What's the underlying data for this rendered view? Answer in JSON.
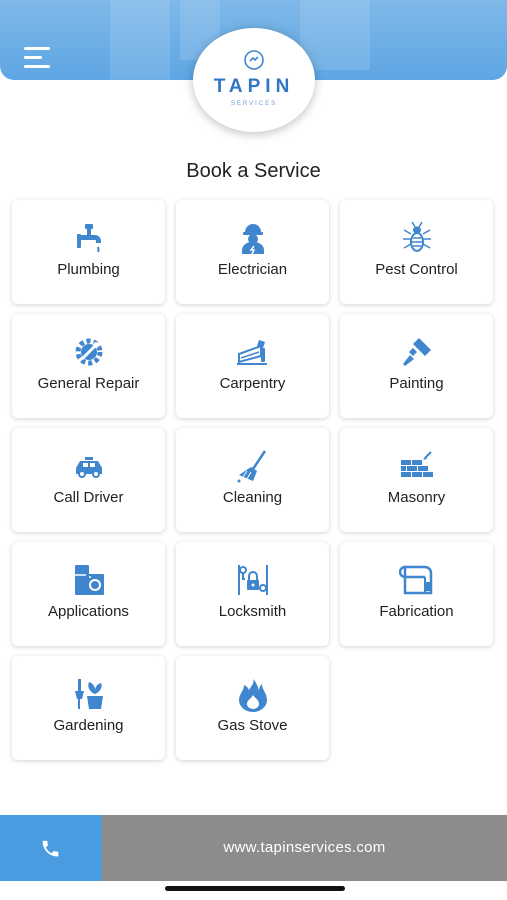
{
  "header": {
    "logo_name": "TAPIN",
    "logo_sub": "SERVICES"
  },
  "page_title": "Book a Service",
  "services": [
    {
      "label": "Plumbing",
      "icon": "faucet-icon"
    },
    {
      "label": "Electrician",
      "icon": "electrician-icon"
    },
    {
      "label": "Pest Control",
      "icon": "bug-icon"
    },
    {
      "label": "General Repair",
      "icon": "gear-wrench-icon"
    },
    {
      "label": "Carpentry",
      "icon": "saw-icon"
    },
    {
      "label": "Painting",
      "icon": "paintbrush-icon"
    },
    {
      "label": "Call Driver",
      "icon": "car-icon"
    },
    {
      "label": "Cleaning",
      "icon": "broom-icon"
    },
    {
      "label": "Masonry",
      "icon": "brick-wall-icon"
    },
    {
      "label": "Applications",
      "icon": "appliances-icon"
    },
    {
      "label": "Locksmith",
      "icon": "lock-icon"
    },
    {
      "label": "Fabrication",
      "icon": "fabrication-icon"
    },
    {
      "label": "Gardening",
      "icon": "plant-icon"
    },
    {
      "label": "Gas Stove",
      "icon": "flame-icon"
    }
  ],
  "footer": {
    "website": "www.tapinservices.com",
    "call_icon": "phone-icon"
  },
  "colors": {
    "primary": "#4a9be0",
    "icon": "#3f86cf",
    "footer_gray": "#8c8c8c"
  }
}
